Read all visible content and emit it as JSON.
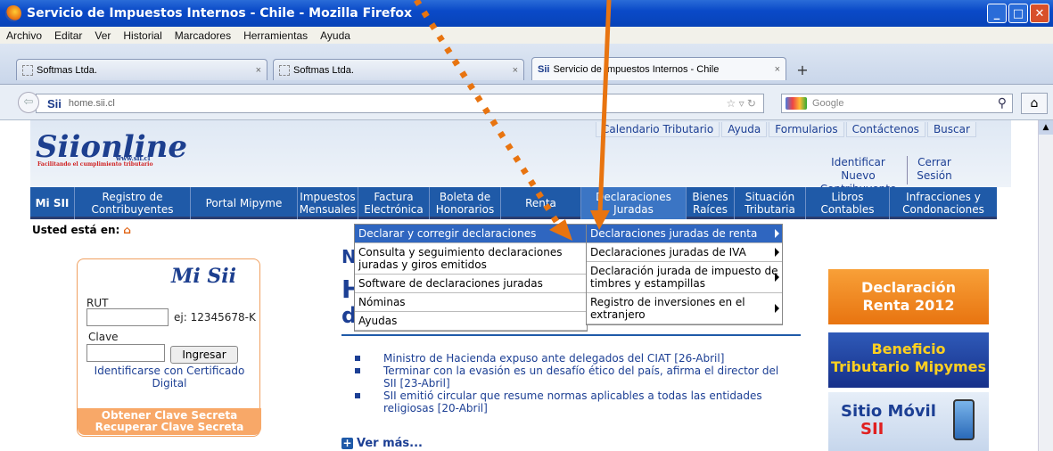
{
  "window": {
    "title": "Servicio de Impuestos Internos - Chile - Mozilla Firefox"
  },
  "menubar": [
    "Archivo",
    "Editar",
    "Ver",
    "Historial",
    "Marcadores",
    "Herramientas",
    "Ayuda"
  ],
  "tabs": [
    {
      "label": "Softmas Ltda.",
      "close": "×"
    },
    {
      "label": "Softmas Ltda.",
      "close": "×"
    },
    {
      "label": "Servicio de Impuestos Internos - Chile",
      "close": "×"
    }
  ],
  "new_tab": "+",
  "navbar": {
    "url_prefix": "Sii",
    "url": "home.sii.cl",
    "search_placeholder": "Google"
  },
  "site": {
    "logo": "Siionline",
    "logo_url": "www.sii.cl",
    "logo_tagline": "Facilitando el cumplimiento tributario",
    "top_links": [
      "Calendario Tributario",
      "Ayuda",
      "Formularios",
      "Contáctenos",
      "Buscar"
    ],
    "identify": "Identificar Nuevo Contribuyente",
    "logout": "Cerrar Sesión"
  },
  "main_nav": [
    {
      "label": "Mi SII"
    },
    {
      "label": "Registro de Contribuyentes"
    },
    {
      "label": "Portal Mipyme"
    },
    {
      "label": "Impuestos Mensuales"
    },
    {
      "label": "Factura Electrónica"
    },
    {
      "label": "Boleta de Honorarios"
    },
    {
      "label": "Renta"
    },
    {
      "label": "Declaraciones Juradas"
    },
    {
      "label": "Bienes Raíces"
    },
    {
      "label": "Situación Tributaria"
    },
    {
      "label": "Libros Contables"
    },
    {
      "label": "Infracciones y Condonaciones"
    }
  ],
  "breadcrumb": {
    "label": "Usted está en:"
  },
  "dropdown1": [
    "Declarar y corregir declaraciones",
    "Consulta y seguimiento declaraciones juradas y giros emitidos",
    "Software de declaraciones juradas",
    "Nóminas",
    "Ayudas"
  ],
  "dropdown2": [
    "Declaraciones juradas de renta",
    "Declaraciones juradas de IVA",
    "Declaración jurada de impuesto de timbres y estampillas",
    "Registro de inversiones en el extranjero"
  ],
  "login": {
    "brand": "Mi Sii",
    "rut_label": "RUT",
    "rut_hint": "ej: 12345678-K",
    "clave_label": "Clave",
    "submit": "Ingresar",
    "cert_link": "Identificarse con Certificado Digital",
    "clave_links": [
      "Obtener Clave Secreta",
      "Recuperar Clave Secreta"
    ]
  },
  "news": {
    "headline_letters": [
      "N",
      "H",
      "d"
    ],
    "items": [
      "Ministro de Hacienda expuso ante delegados del CIAT [26-Abril]",
      "Terminar con la evasión es un desafío ético del país, afirma el director del SII [23-Abril]",
      "SII emitió circular que resume normas aplicables a todas las entidades religiosas [20-Abril]"
    ],
    "more": "Ver más..."
  },
  "banners": {
    "b1": [
      "Declaración",
      "Renta 2012"
    ],
    "b2": [
      "Beneficio",
      "Tributario Mipymes"
    ],
    "b3": [
      "Sitio Móvil",
      "SII"
    ]
  },
  "colors": {
    "nav": "#1f5aa8",
    "annotation_arrow": "#e87410",
    "menu_highlight": "#2f66c0"
  }
}
